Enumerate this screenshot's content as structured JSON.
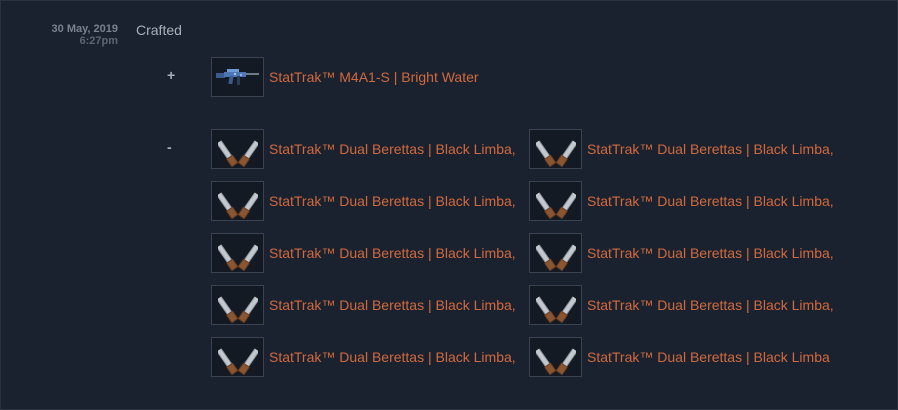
{
  "history": {
    "date": "30 May, 2019",
    "time": "6:27pm",
    "event_label": "Crafted",
    "plus_sign": "+",
    "minus_sign": "-",
    "received": [
      {
        "name": "StatTrak™ M4A1-S | Bright Water",
        "icon": "m4a1s-rifle-icon"
      }
    ],
    "removed": [
      {
        "name": "StatTrak™ Dual Berettas | Black Limba,",
        "icon": "dual-berettas-icon"
      },
      {
        "name": "StatTrak™ Dual Berettas | Black Limba,",
        "icon": "dual-berettas-icon"
      },
      {
        "name": "StatTrak™ Dual Berettas | Black Limba,",
        "icon": "dual-berettas-icon"
      },
      {
        "name": "StatTrak™ Dual Berettas | Black Limba,",
        "icon": "dual-berettas-icon"
      },
      {
        "name": "StatTrak™ Dual Berettas | Black Limba,",
        "icon": "dual-berettas-icon"
      },
      {
        "name": "StatTrak™ Dual Berettas | Black Limba,",
        "icon": "dual-berettas-icon"
      },
      {
        "name": "StatTrak™ Dual Berettas | Black Limba,",
        "icon": "dual-berettas-icon"
      },
      {
        "name": "StatTrak™ Dual Berettas | Black Limba,",
        "icon": "dual-berettas-icon"
      },
      {
        "name": "StatTrak™ Dual Berettas | Black Limba,",
        "icon": "dual-berettas-icon"
      },
      {
        "name": "StatTrak™ Dual Berettas | Black Limba",
        "icon": "dual-berettas-icon"
      }
    ]
  },
  "colors": {
    "background": "#1a2230",
    "item_name": "#d2693c",
    "text_muted": "#a9b0ba"
  }
}
